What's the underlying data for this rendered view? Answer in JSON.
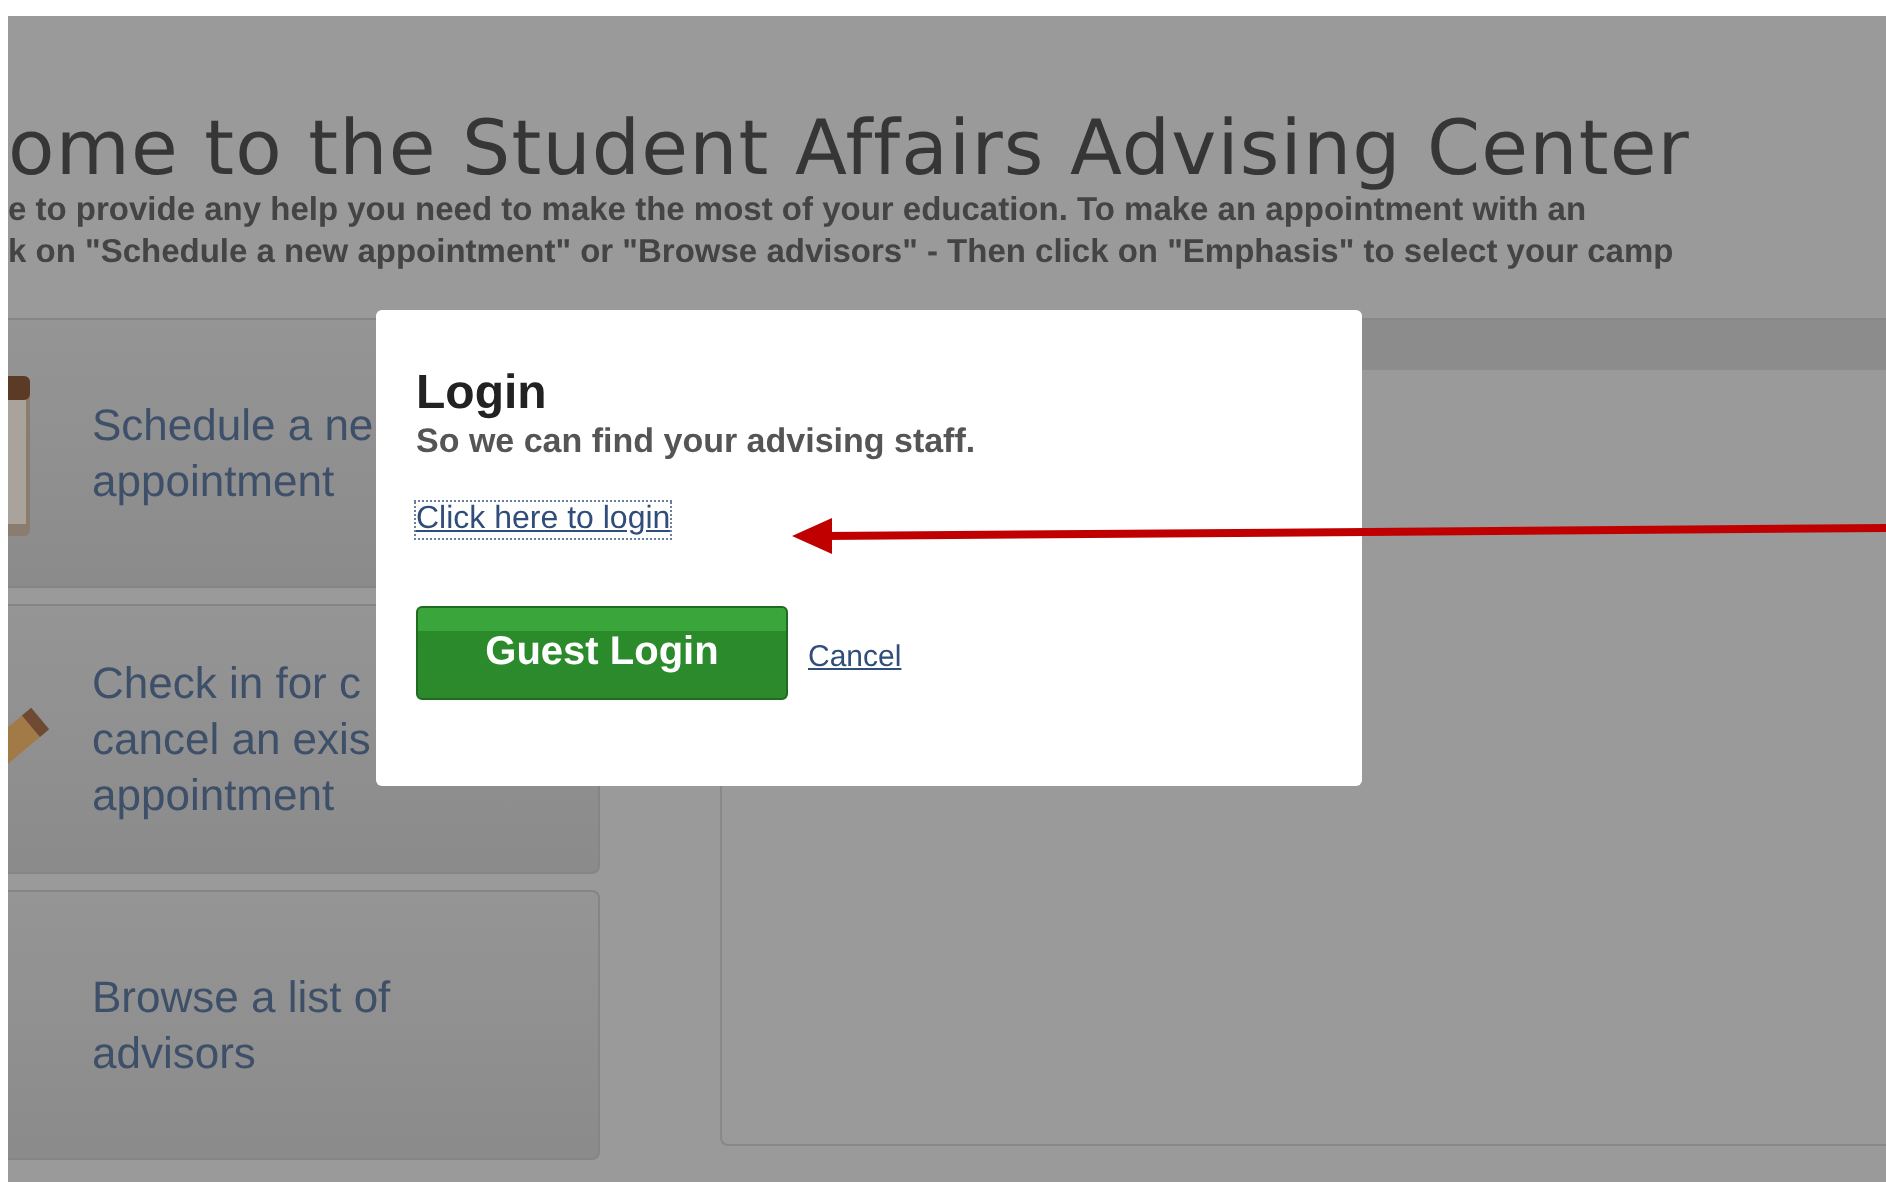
{
  "page": {
    "heading": "ome to the Student Affairs Advising Center",
    "intro_lines": [
      "e to provide any help you need to make the most of your education. To make an appointment with an",
      "k on \"Schedule a new appointment\" or \"Browse advisors\" - Then click on \"Emphasis\" to select your camp"
    ]
  },
  "tiles": [
    {
      "kind": "calendar",
      "text": "Schedule a ne\nappointment"
    },
    {
      "kind": "pencil",
      "text": "Check in for c\ncancel an exis\nappointment"
    },
    {
      "kind": "plain",
      "text": "Browse a list of\nadvisors"
    }
  ],
  "dialog": {
    "title": "Login",
    "subtitle": "So we can find your advising staff.",
    "login_link": "Click here to login",
    "primary_button": "Guest Login",
    "cancel_link": "Cancel"
  }
}
